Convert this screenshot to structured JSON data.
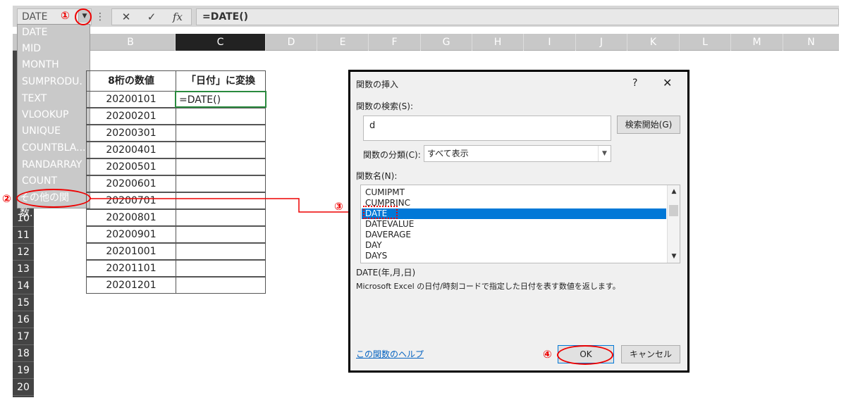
{
  "formula_bar": {
    "name_box": "DATE",
    "dots": "⋮",
    "cancel": "✕",
    "enter": "✓",
    "fx": "fx",
    "formula": "=DATE()"
  },
  "columns": [
    "B",
    "C",
    "D",
    "E",
    "F",
    "G",
    "H",
    "I",
    "J",
    "K",
    "L",
    "M",
    "N"
  ],
  "rows": [
    "10",
    "11",
    "12",
    "13",
    "14",
    "15",
    "16",
    "17",
    "18",
    "19",
    "20"
  ],
  "name_box_menu": {
    "items": [
      "DATE",
      "MID",
      "MONTH",
      "SUMPRODU.",
      "TEXT",
      "VLOOKUP",
      "UNIQUE",
      "COUNTBLA...",
      "RANDARRAY",
      "COUNT"
    ],
    "more": "その他の関数..."
  },
  "sheet": {
    "header_b": "8桁の数値",
    "header_c": "「日付」に変換",
    "values": [
      "20200101",
      "20200201",
      "20200301",
      "20200401",
      "20200501",
      "20200601",
      "20200701",
      "20200801",
      "20200901",
      "20201001",
      "20201101",
      "20201201"
    ],
    "c_first": "=DATE()"
  },
  "dialog": {
    "title": "関数の挿入",
    "help_btn": "?",
    "close_btn": "✕",
    "search_label": "関数の検索(S):",
    "search_value": "d",
    "search_button": "検索開始(G)",
    "category_label": "関数の分類(C):",
    "category_value": "すべて表示",
    "list_label": "関数名(N):",
    "functions": [
      "CUMIPMT",
      "CUMPRINC",
      "DATE",
      "DATEVALUE",
      "DAVERAGE",
      "DAY",
      "DAYS"
    ],
    "selected": "DATE",
    "syntax": "DATE(年,月,日)",
    "description": "Microsoft Excel の日付/時刻コードで指定した日付を表す数値を返します。",
    "help_link": "この関数のヘルプ",
    "ok": "OK",
    "cancel": "キャンセル"
  },
  "annotations": [
    "①",
    "②",
    "③",
    "④"
  ],
  "colors": {
    "annotation": "#ff0000",
    "selection": "#0078d7",
    "active_cell": "#2a8a3e"
  }
}
